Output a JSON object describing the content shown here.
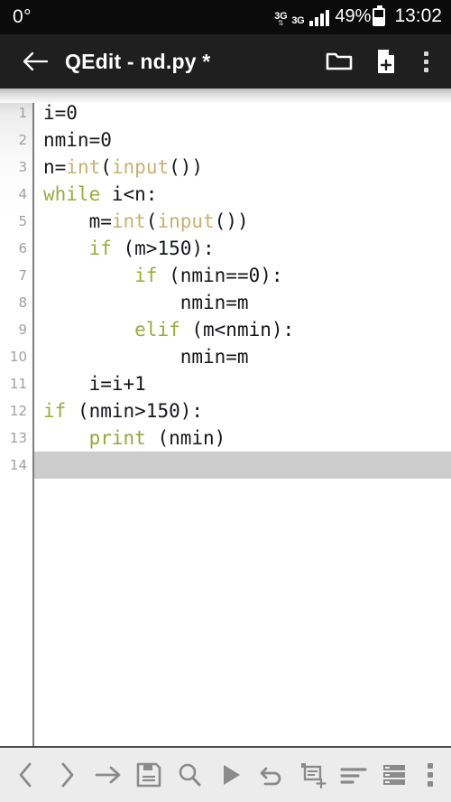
{
  "status_bar": {
    "left_text": "0°",
    "network_primary": "3G",
    "network_secondary": "3G",
    "signal_bars": 4,
    "battery_percent": "49%",
    "battery_level": 50,
    "clock": "13:02"
  },
  "title_bar": {
    "back_icon": "back-arrow-icon",
    "title": "QEdit - nd.py *",
    "open_folder_icon": "folder-icon",
    "new_file_icon": "new-file-icon",
    "overflow_icon": "overflow-menu-icon"
  },
  "editor": {
    "line_numbers": [
      "1",
      "2",
      "3",
      "4",
      "5",
      "6",
      "7",
      "8",
      "9",
      "10",
      "11",
      "12",
      "13",
      "14"
    ],
    "current_line": 14,
    "lines": [
      {
        "n": 1,
        "tokens": [
          {
            "t": "i=0",
            "c": "plain"
          }
        ]
      },
      {
        "n": 2,
        "tokens": [
          {
            "t": "nmin=0",
            "c": "plain"
          }
        ]
      },
      {
        "n": 3,
        "tokens": [
          {
            "t": "n=",
            "c": "plain"
          },
          {
            "t": "int",
            "c": "fn"
          },
          {
            "t": "(",
            "c": "plain"
          },
          {
            "t": "input",
            "c": "fn"
          },
          {
            "t": "())",
            "c": "plain"
          }
        ]
      },
      {
        "n": 4,
        "tokens": [
          {
            "t": "while",
            "c": "kw"
          },
          {
            "t": " i<n:",
            "c": "plain"
          }
        ]
      },
      {
        "n": 5,
        "tokens": [
          {
            "t": "    m=",
            "c": "plain"
          },
          {
            "t": "int",
            "c": "fn"
          },
          {
            "t": "(",
            "c": "plain"
          },
          {
            "t": "input",
            "c": "fn"
          },
          {
            "t": "())",
            "c": "plain"
          }
        ]
      },
      {
        "n": 6,
        "tokens": [
          {
            "t": "    ",
            "c": "plain"
          },
          {
            "t": "if",
            "c": "kw"
          },
          {
            "t": " (m>150):",
            "c": "plain"
          }
        ]
      },
      {
        "n": 7,
        "tokens": [
          {
            "t": "        ",
            "c": "plain"
          },
          {
            "t": "if",
            "c": "kw"
          },
          {
            "t": " (nmin==0):",
            "c": "plain"
          }
        ]
      },
      {
        "n": 8,
        "tokens": [
          {
            "t": "            nmin=m",
            "c": "plain"
          }
        ]
      },
      {
        "n": 9,
        "tokens": [
          {
            "t": "        ",
            "c": "plain"
          },
          {
            "t": "elif",
            "c": "kw"
          },
          {
            "t": " (m<nmin):",
            "c": "plain"
          }
        ]
      },
      {
        "n": 10,
        "tokens": [
          {
            "t": "            nmin=m",
            "c": "plain"
          }
        ]
      },
      {
        "n": 11,
        "tokens": [
          {
            "t": "    i=i+1",
            "c": "plain"
          }
        ]
      },
      {
        "n": 12,
        "tokens": [
          {
            "t": "",
            "c": "plain"
          },
          {
            "t": "if",
            "c": "kw"
          },
          {
            "t": " (nmin>150):",
            "c": "plain"
          }
        ]
      },
      {
        "n": 13,
        "tokens": [
          {
            "t": "    ",
            "c": "plain"
          },
          {
            "t": "print",
            "c": "print"
          },
          {
            "t": " (nmin)",
            "c": "plain"
          }
        ]
      },
      {
        "n": 14,
        "tokens": [
          {
            "t": "",
            "c": "plain"
          }
        ]
      }
    ]
  },
  "toolbar": {
    "items": [
      {
        "name": "prev-button",
        "icon": "chevron-left-icon"
      },
      {
        "name": "next-button",
        "icon": "chevron-right-icon"
      },
      {
        "name": "indent-tab-button",
        "icon": "arrow-right-icon"
      },
      {
        "name": "save-button",
        "icon": "floppy-save-icon"
      },
      {
        "name": "search-button",
        "icon": "magnifier-search-icon"
      },
      {
        "name": "run-button",
        "icon": "play-run-icon"
      },
      {
        "name": "undo-button",
        "icon": "undo-arrow-icon"
      },
      {
        "name": "new-snippet-button",
        "icon": "window-plus-icon"
      },
      {
        "name": "format-align-button",
        "icon": "align-left-icon"
      },
      {
        "name": "list-view-button",
        "icon": "list-rows-icon"
      },
      {
        "name": "toolbar-overflow-button",
        "icon": "overflow-menu-icon"
      }
    ]
  },
  "colors": {
    "status_bar_bg": "#0b0b0b",
    "title_bar_bg": "#1f1f1f",
    "toolbar_bg": "#ececec",
    "icon_gray": "#8a8a8a",
    "keyword": "#9aab3e",
    "function": "#c9b071",
    "print": "#93a63b",
    "code_text": "#15171a",
    "current_line_highlight": "#cccccc",
    "gutter_number": "#a0a0a0"
  }
}
